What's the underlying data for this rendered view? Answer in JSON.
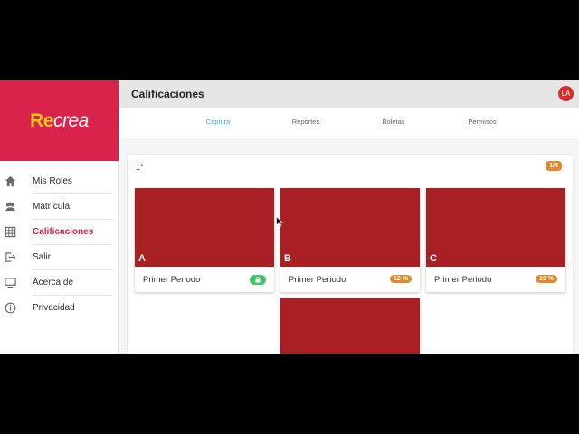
{
  "brand": {
    "logo_re": "Re",
    "logo_crea": "crea"
  },
  "header": {
    "title": "Calificaciones",
    "avatar_initials": "LA"
  },
  "sidebar": {
    "items": [
      {
        "label": "Mis Roles",
        "icon": "home-icon"
      },
      {
        "label": "Matrícula",
        "icon": "group-icon"
      },
      {
        "label": "Calificaciones",
        "icon": "grid-icon",
        "active": true
      },
      {
        "label": "Salir",
        "icon": "logout-icon"
      },
      {
        "label": "Acerca de",
        "icon": "monitor-icon"
      },
      {
        "label": "Privacidad",
        "icon": "info-icon"
      }
    ]
  },
  "tabs": [
    {
      "label": "Captura",
      "active": true
    },
    {
      "label": "Reportes"
    },
    {
      "label": "Boletas"
    },
    {
      "label": "Permisos"
    }
  ],
  "grade": {
    "label": "1°",
    "count": "1/4"
  },
  "groups": [
    {
      "letter": "A",
      "period": "Primer Periodo",
      "badge": "lock-icon",
      "badge_color": "#47c16a"
    },
    {
      "letter": "B",
      "period": "Primer Periodo",
      "badge": "12 %",
      "badge_color": "#e08a2e"
    },
    {
      "letter": "C",
      "period": "Primer Periodo",
      "badge": "19 %",
      "badge_color": "#e08a2e"
    }
  ],
  "colors": {
    "brand": "#d8244a",
    "accent_tab": "#3ea7d8",
    "card_cover": "#a82024"
  }
}
